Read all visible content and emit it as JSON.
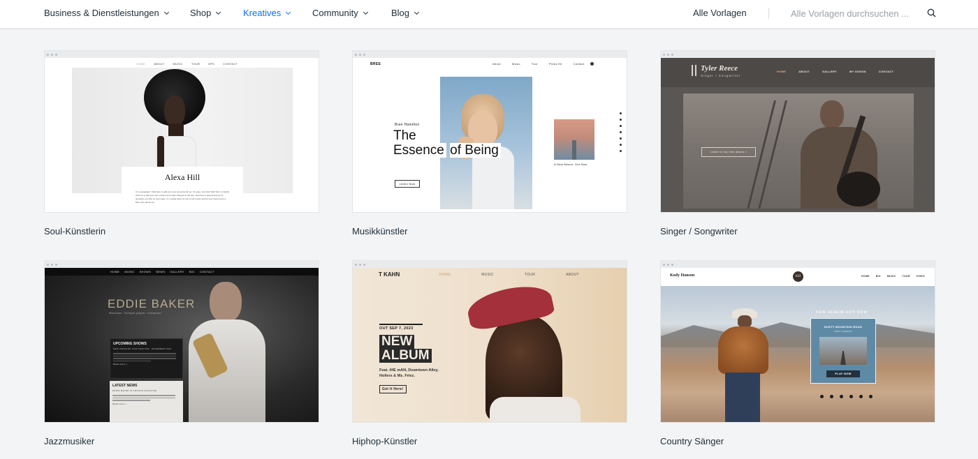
{
  "nav": {
    "items": [
      {
        "label": "Business & Dienstleistungen",
        "active": false
      },
      {
        "label": "Shop",
        "active": false
      },
      {
        "label": "Kreatives",
        "active": true
      },
      {
        "label": "Community",
        "active": false
      },
      {
        "label": "Blog",
        "active": false
      }
    ],
    "all_templates": "Alle Vorlagen",
    "search_placeholder": "Alle Vorlagen durchsuchen ...",
    "accent_color": "#116dff"
  },
  "templates": [
    {
      "caption": "Soul-Künstlerin",
      "preview": {
        "menu": [
          "HOME",
          "ABOUT",
          "MUSIC",
          "TOUR",
          "EPK",
          "CONTACT"
        ],
        "name": "Alexa Hill",
        "body": "I'm a paragraph. Click here to add your own text and edit me. It's easy. Just click \"Edit Text\" or double click me to add your own content and make changes to the font. Feel free to drag and drop me anywhere you like on your page. I'm a great place for you to tell a story and let your users know a little more about you."
      }
    },
    {
      "caption": "Musikkünstler",
      "preview": {
        "logo": "BREE",
        "menu": [
          "About",
          "Music",
          "Tour",
          "Press Kit",
          "Contact"
        ],
        "artist": "Bree Hamilton",
        "headline": [
          "The",
          "Essence",
          "of Being"
        ],
        "button": "Listen Now",
        "album_caption": "A New Album: Out Now"
      }
    },
    {
      "caption": "Singer / Songwriter",
      "preview": {
        "name": "Tyler Reece",
        "subtitle": "Singer / Songwriter",
        "menu": [
          "HOME",
          "ABOUT",
          "GALLERY",
          "MY SONGS",
          "CONTACT"
        ],
        "button": "Listen to my new album >"
      }
    },
    {
      "caption": "Jazzmusiker",
      "preview": {
        "menu": [
          "HOME",
          "MUSIC",
          "SHOWS",
          "NEWS",
          "GALLERY",
          "BIO",
          "CONTACT"
        ],
        "name": "EDDIE BAKER",
        "tagline": "Musician. Trumpet player. Composer",
        "box1_title": "UPCOMING SHOWS",
        "box1_sub": "NEW ORLEANS JAZZ FESTIVAL, NOVEMBER 2023",
        "box1_more": "Read more >",
        "box2_title": "LATEST NEWS",
        "box2_sub": "EDDIE BAKER IN GROOVE MAGAZINE",
        "box2_more": "Read more >"
      }
    },
    {
      "caption": "Hiphop-Künstler",
      "preview": {
        "logo": "T KAHN",
        "menu": [
          "HOME",
          "MUSIC",
          "TOUR",
          "ABOUT"
        ],
        "date": "OUT SEP 7, 2023",
        "headline": [
          "NEW",
          "ALBUM"
        ],
        "feat": "Feat. tHE mAN, Downtown Alley, Hollers & Ms. Friez.",
        "button": "Get It Here!"
      }
    },
    {
      "caption": "Country Sänger",
      "preview": {
        "name": "Kody Hanson",
        "monogram": "KH",
        "menu": [
          "HOME",
          "BIO",
          "MUSIC",
          "TOUR",
          "VIDEO"
        ],
        "announce": "NEW ALBUM OUT NOW",
        "album_title": "DUSTY MOUNTAIN ROAD",
        "album_artist": "KODY HANSON",
        "button": "PLAY NOW"
      }
    }
  ]
}
